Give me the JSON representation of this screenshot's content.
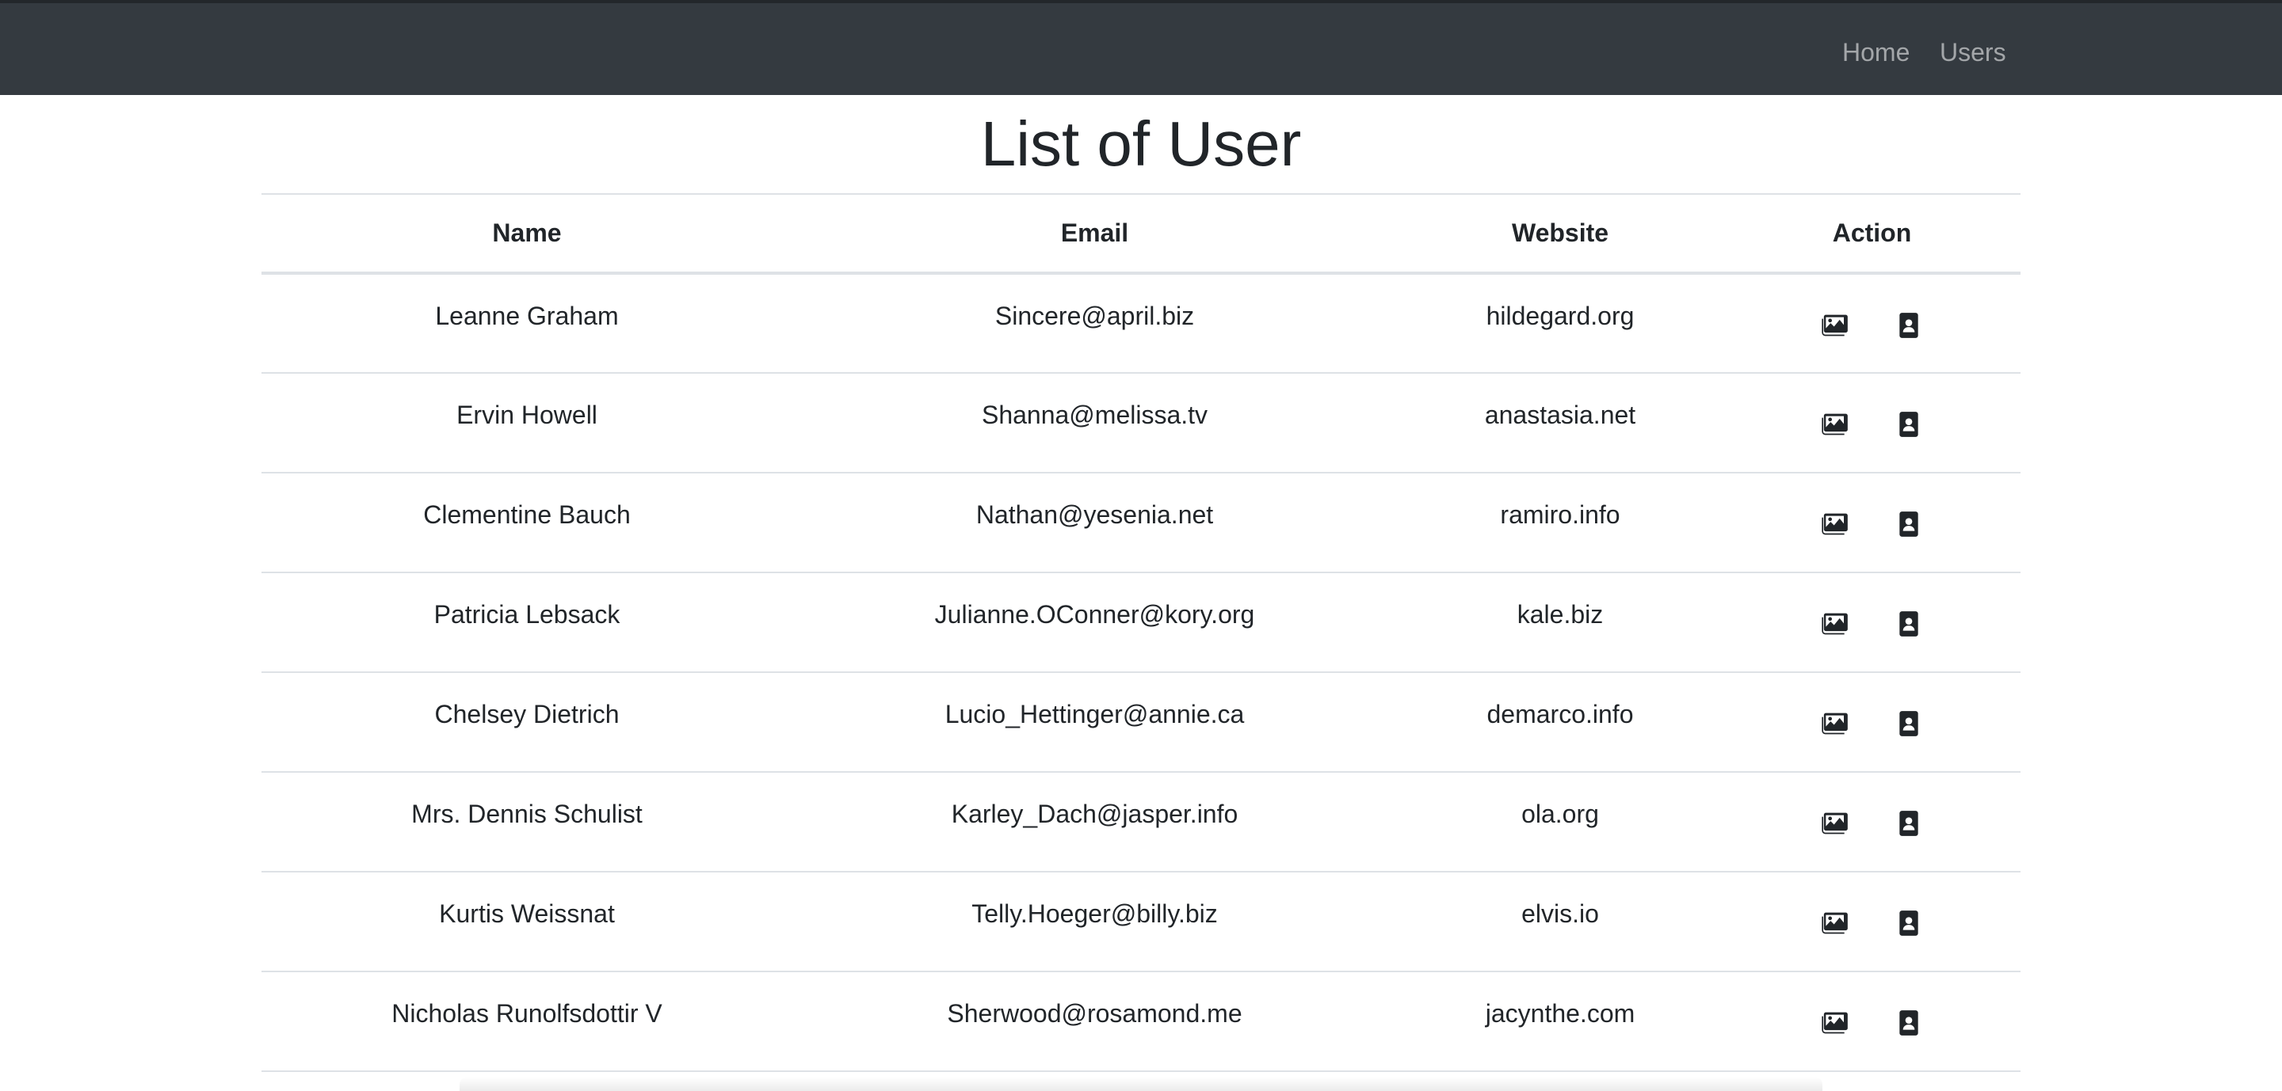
{
  "nav": {
    "home_label": "Home",
    "users_label": "Users",
    "background": "#343a40"
  },
  "page": {
    "title": "List of User"
  },
  "table": {
    "headers": {
      "name": "Name",
      "email": "Email",
      "website": "Website",
      "action": "Action"
    },
    "rows": [
      {
        "name": "Leanne Graham",
        "email": "Sincere@april.biz",
        "website": "hildegard.org"
      },
      {
        "name": "Ervin Howell",
        "email": "Shanna@melissa.tv",
        "website": "anastasia.net"
      },
      {
        "name": "Clementine Bauch",
        "email": "Nathan@yesenia.net",
        "website": "ramiro.info"
      },
      {
        "name": "Patricia Lebsack",
        "email": "Julianne.OConner@kory.org",
        "website": "kale.biz"
      },
      {
        "name": "Chelsey Dietrich",
        "email": "Lucio_Hettinger@annie.ca",
        "website": "demarco.info"
      },
      {
        "name": "Mrs. Dennis Schulist",
        "email": "Karley_Dach@jasper.info",
        "website": "ola.org"
      },
      {
        "name": "Kurtis Weissnat",
        "email": "Telly.Hoeger@billy.biz",
        "website": "elvis.io"
      },
      {
        "name": "Nicholas Runolfsdottir V",
        "email": "Sherwood@rosamond.me",
        "website": "jacynthe.com"
      }
    ],
    "action_icons": [
      "photos-icon",
      "user-profile-icon"
    ]
  }
}
